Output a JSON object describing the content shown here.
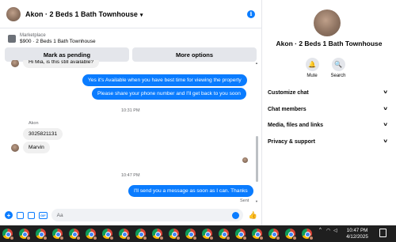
{
  "header": {
    "title": "Akon · 2 Beds 1 Bath Townhouse",
    "chevron": "chevron-down-icon",
    "info": "i"
  },
  "marketplace": {
    "category": "Marketplace",
    "item": "$900 · 2 Beds 1 Bath Townhouse"
  },
  "actions": {
    "pending": "Mark as pending",
    "more": "More options"
  },
  "thread": {
    "messages": [
      {
        "dir": "in",
        "text": "Hi Mia, is this still available?"
      },
      {
        "dir": "out",
        "text": "Yes it's Available when you have best time for viewing the property"
      },
      {
        "dir": "out",
        "text": "Please share your phone number and I'll get back to you soon"
      },
      {
        "dir": "out",
        "text": "I'll send you a message as soon as I can. Thanks"
      }
    ],
    "time1": "10:31 PM",
    "sender": "Akon",
    "in_phone": "3025821131",
    "in_name": "Marvin",
    "time2": "10:47 PM",
    "status": "Sent"
  },
  "composer": {
    "placeholder": "Aa",
    "gif": "GIF"
  },
  "info_panel": {
    "name": "Akon · 2 Beds 1 Bath Townhouse",
    "mute": "Mute",
    "search": "Search",
    "sections": [
      "Customize chat",
      "Chat members",
      "Media, files and links",
      "Privacy & support"
    ]
  },
  "taskbar": {
    "time": "10:47 PM",
    "date": "4/12/2025"
  },
  "colors": {
    "accent": "#0a7cff",
    "bubble_in": "#f0f0f0",
    "taskbar": "#1f1f1f"
  }
}
